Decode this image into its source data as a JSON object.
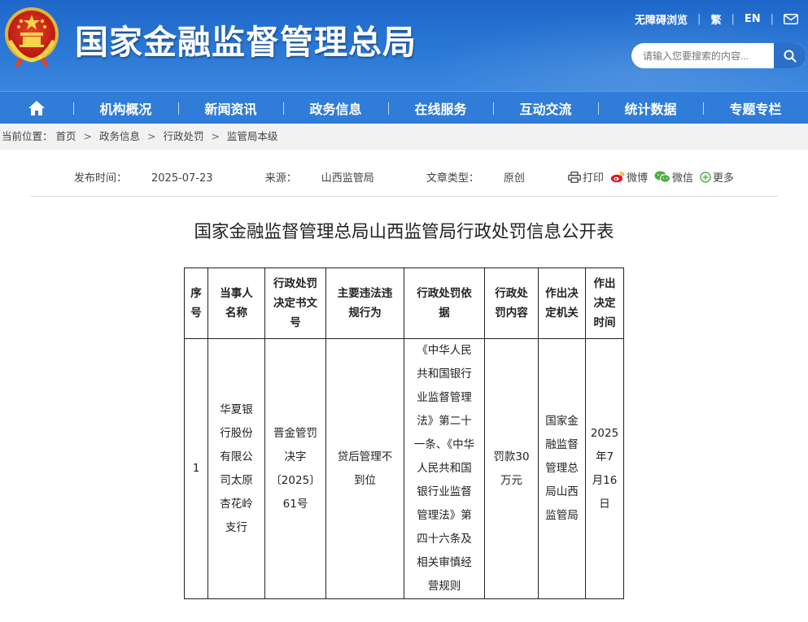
{
  "header": {
    "site_title": "国家金融监督管理总局",
    "accessibility": "无障碍浏览",
    "traditional": "繁",
    "english": "EN",
    "search_placeholder": "请输入您要搜索的内容..."
  },
  "nav": {
    "items": [
      "机构概况",
      "新闻资讯",
      "政务信息",
      "在线服务",
      "互动交流",
      "统计数据",
      "专题专栏"
    ]
  },
  "breadcrumb": {
    "prefix": "当前位置：",
    "items": [
      "首页",
      "政务信息",
      "行政处罚",
      "监管局本级"
    ],
    "separator": ">"
  },
  "article": {
    "publish_label": "发布时间：",
    "publish_date": "2025-07-23",
    "source_label": "来源：",
    "source": "山西监管局",
    "type_label": "文章类型：",
    "type": "原创",
    "share": {
      "print": "打印",
      "weibo": "微博",
      "wechat": "微信",
      "more": "更多"
    },
    "title": "国家金融监督管理总局山西监管局行政处罚信息公开表"
  },
  "table": {
    "headers": [
      "序\n号",
      "当事人\n名称",
      "行政处罚\n决定书文\n号",
      "主要违法违\n规行为",
      "行政处罚依\n据",
      "行政处\n罚内容",
      "作出决\n定机关",
      "作出\n决定\n时间"
    ],
    "rows": [
      [
        "1",
        "华夏银\n行股份\n有限公\n司太原\n杏花岭\n支行",
        "晋金管罚\n决字\n〔2025〕\n61号",
        "贷后管理不\n到位",
        "《中华人民\n共和国银行\n业监督管理\n法》第二十\n一条、《中华\n人民共和国\n银行业监督\n管理法》第\n四十六条及\n相关审慎经\n营规则",
        "罚款30\n万元",
        "国家金\n融监督\n管理总\n局山西\n监管局",
        "2025\n年7\n月16\n日"
      ]
    ]
  }
}
